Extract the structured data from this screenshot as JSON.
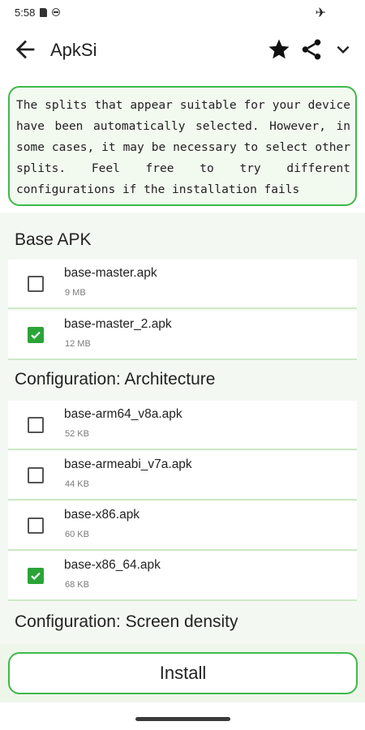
{
  "status_bar": {
    "time": "5:58",
    "icons": [
      "sd-card-icon",
      "vpn-icon",
      "airplane-mode-icon"
    ]
  },
  "app_bar": {
    "title": "ApkSi",
    "icons": [
      "back-arrow-icon",
      "star-icon",
      "share-icon",
      "chevron-down-icon"
    ]
  },
  "notice": {
    "text": "The splits that appear suitable for your device have been automatically selected. However, in some cases, it may be necessary to select other splits. Feel free to try different configurations if the installation fails",
    "border_color": "#3fb94a"
  },
  "sections": [
    {
      "title": "Base APK",
      "items": [
        {
          "name": "base-master.apk",
          "size": "9 MB",
          "checked": false
        },
        {
          "name": "base-master_2.apk",
          "size": "12 MB",
          "checked": true
        }
      ]
    },
    {
      "title": "Configuration: Architecture",
      "items": [
        {
          "name": "base-arm64_v8a.apk",
          "size": "52 KB",
          "checked": false
        },
        {
          "name": "base-armeabi_v7a.apk",
          "size": "44 KB",
          "checked": false
        },
        {
          "name": "base-x86.apk",
          "size": "60 KB",
          "checked": false
        },
        {
          "name": "base-x86_64.apk",
          "size": "68 KB",
          "checked": true
        }
      ]
    },
    {
      "title": "Configuration: Screen density",
      "items": []
    }
  ],
  "install_button": {
    "label": "Install"
  },
  "colors": {
    "accent": "#2aa437",
    "outline": "#3fb94a",
    "background_tint": "#f4f8f2"
  }
}
